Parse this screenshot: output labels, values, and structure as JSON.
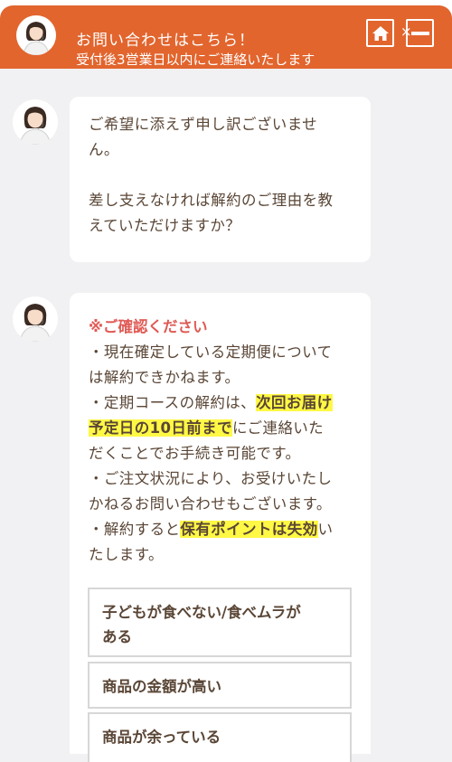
{
  "header": {
    "title": "お問い合わせはこちら！",
    "subtitle": "受付後3営業日以内にご連絡いたします",
    "home_icon": "home-icon",
    "minimize_icon": "minimize-icon",
    "minimize_mark": "×",
    "accent_color": "#e2652e"
  },
  "messages": [
    {
      "lines": [
        "ご希望に添えず申し訳ございませ",
        "ん。",
        "",
        "差し支えなければ解約のご理由を教",
        "えていただけますか？"
      ]
    },
    {
      "notice_title": "※ご確認ください",
      "l1": "・現在確定している定期便について",
      "l2": "は解約できかねます。",
      "l3a": "・定期コースの解約は、",
      "l3b": "次回お届け",
      "l4a": "予定日の10日前まで",
      "l4b": "にご連絡いた",
      "l5": "だくことでお手続き可能です。",
      "l6": "・ご注文状況により、お受けいたし",
      "l7": "かねるお問い合わせもございます。",
      "l8a": "・解約すると",
      "l8b": "保有ポイントは失効",
      "l8c": "い",
      "l9": "たします。"
    }
  ],
  "options": [
    {
      "line1": "子どもが食べない/食べムラが",
      "line2": "ある"
    },
    {
      "line1": "商品の金額が高い"
    },
    {
      "line1": "商品が余っている"
    }
  ]
}
